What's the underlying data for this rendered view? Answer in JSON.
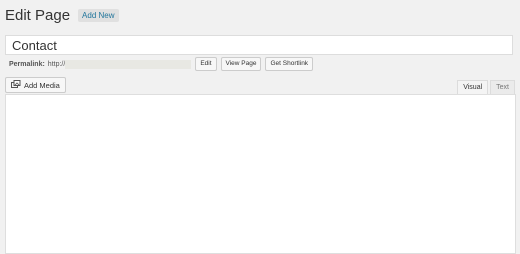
{
  "header": {
    "title": "Edit Page",
    "add_new_label": "Add New"
  },
  "post": {
    "title_value": "Contact"
  },
  "permalink": {
    "label": "Permalink:",
    "base": "http://",
    "edit_label": "Edit",
    "view_page_label": "View Page",
    "shortlink_label": "Get Shortlink"
  },
  "toolbar": {
    "add_media_label": "Add Media",
    "add_media_icon": "media-icon"
  },
  "editor_tabs": {
    "visual_label": "Visual",
    "text_label": "Text",
    "active": "Visual"
  },
  "editor": {
    "content": ""
  }
}
